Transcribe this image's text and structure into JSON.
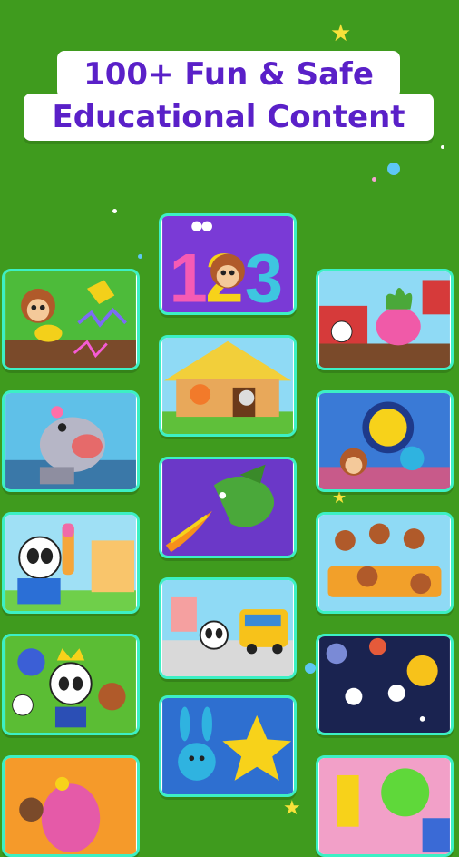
{
  "headline": {
    "line1": "100+ Fun & Safe",
    "line2": "Educational Content"
  },
  "cards": [
    {
      "name": "monkey-dino-card",
      "scene": "monkey-dino"
    },
    {
      "name": "hippo-card",
      "scene": "hippo"
    },
    {
      "name": "panda-icecream-card",
      "scene": "panda-icecream"
    },
    {
      "name": "panda-king-card",
      "scene": "panda-king"
    },
    {
      "name": "elephant-card",
      "scene": "elephant"
    },
    {
      "name": "numbers-123-card",
      "scene": "numbers"
    },
    {
      "name": "straw-house-card",
      "scene": "straw-house"
    },
    {
      "name": "dragon-card",
      "scene": "dragon"
    },
    {
      "name": "school-bus-card",
      "scene": "bus"
    },
    {
      "name": "twinkle-star-card",
      "scene": "twinkle-star"
    },
    {
      "name": "farm-turnip-card",
      "scene": "farm"
    },
    {
      "name": "moon-room-card",
      "scene": "moon-room"
    },
    {
      "name": "five-monkeys-bed-card",
      "scene": "monkeys-bed"
    },
    {
      "name": "space-planets-card",
      "scene": "space"
    },
    {
      "name": "colorful-shapes-card",
      "scene": "shapes"
    }
  ]
}
